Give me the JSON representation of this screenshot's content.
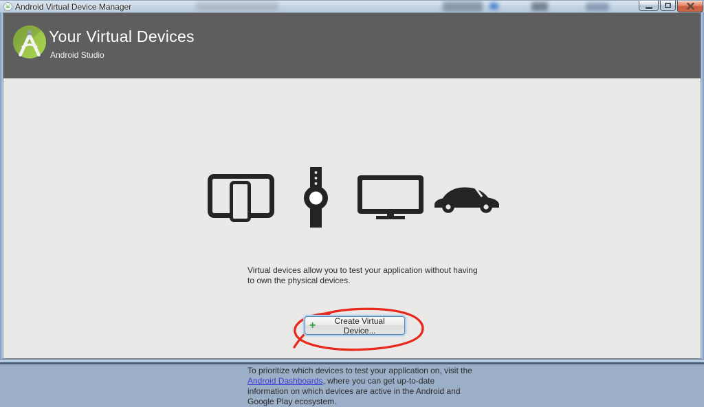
{
  "window": {
    "title": "Android Virtual Device Manager",
    "controls": {
      "minimize": "minimize-window",
      "maximize": "maximize-window",
      "close": "close-window"
    }
  },
  "header": {
    "title": "Your Virtual Devices",
    "subtitle": "Android Studio"
  },
  "hero_icons": [
    "tablet-phone-icon",
    "watch-icon",
    "tv-icon",
    "car-icon"
  ],
  "content": {
    "intro": "Virtual devices allow you to test your application without having\nto own the physical devices.",
    "button": {
      "plus": "+",
      "label": "Create Virtual Device..."
    },
    "footer": {
      "before_link": "To prioritize which devices to test your application on, visit the\n",
      "link_text": "Android Dashboards",
      "after_link": ", where you can get up-to-date\ninformation on which devices are active in the Android and\nGoogle Play ecosystem."
    }
  },
  "colors": {
    "header_bg": "#5e5e5e",
    "canvas_bg": "#eae9e7",
    "icon_dark": "#242424",
    "logo_green": "#9cc74c",
    "plus_green": "#2ea043",
    "link_blue": "#3b3bd4",
    "annotation_red": "#e8281b",
    "close_button_red": "#cd5b41"
  }
}
